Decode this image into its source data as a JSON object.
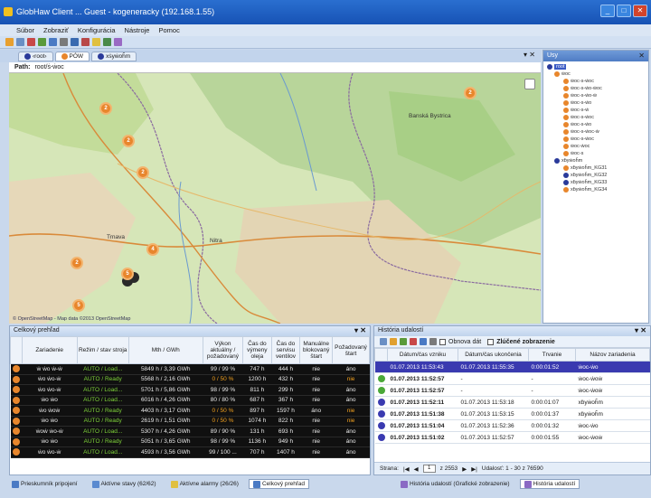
{
  "window": {
    "title": "GlobHaw Client ... Guest - kogeneracky (192.168.1.55)"
  },
  "menu": [
    "Súbor",
    "Zobraziť",
    "Konfigurácia",
    "Nástroje",
    "Pomoc"
  ],
  "tabs": [
    {
      "label": "‹root›",
      "icon": "root-icon",
      "color": "#2a3a9a"
    },
    {
      "label": "PÓW",
      "icon": "orange-dot-icon",
      "color": "#e8862c"
    },
    {
      "label": "xṡyẇoĥm",
      "icon": "blue-dot-icon",
      "color": "#2a3a9a"
    }
  ],
  "path": {
    "label": "Path:",
    "value": "root/ṡ-ẇoc"
  },
  "map": {
    "labels": {
      "banska": "Banská Bystrica",
      "trnava": "Trnava",
      "nitra": "Nitra"
    },
    "clusters": [
      "2",
      "2",
      "2",
      "2",
      "4",
      "2",
      "5",
      "5"
    ],
    "attribution": "© OpenStreetMap - Map data ©2013 OpenStreetMap"
  },
  "tree": {
    "title": "Usy",
    "items": [
      "root",
      "ẇoc",
      "ẇoc-s-ẇoc",
      "ẇoc-s-ẇo-ẇoc",
      "ẇoc-s-ẇo-ẇ",
      "ẇoc-s-ẇo",
      "ẇoc-s-ẇ",
      "ẇoc-s-ẇoc",
      "ẇoc-s-ẇo",
      "ẇoc-s-ẇoc-ẇ",
      "ẇoc-s-ẇoc",
      "ẇoc-ẇoc",
      "ẇoc-s",
      "xḃyẇoĥm",
      "xḃyẇoĥm_KG31",
      "xḃyẇoĥm_KG32",
      "xḃyẇoĥm_KG33",
      "xḃyẇoĥm_KG34"
    ]
  },
  "overview": {
    "title": "Celkový prehľad",
    "headers": [
      "Zariadenie",
      "Režim / stav stroja",
      "Mth / GWh",
      "Výkon aktuálny / požadovaný",
      "Čas do výmeny oleja",
      "Čas do servisu ventilov",
      "Manuálne blokovaný štart",
      "Požadovaný štart"
    ],
    "rows": [
      [
        "ẇ ẇo ẇ-ẇ",
        "AUTO / Load...",
        "5849 h / 3,39 GWh",
        "99 / 99 %",
        "747 h",
        "444 h",
        "nie",
        "áno"
      ],
      [
        "ẇo ẇo-ẇ",
        "AUTO / Ready",
        "5568 h / 2,16 GWh",
        "0 / 50 %",
        "1200 h",
        "432 h",
        "nie",
        "nie"
      ],
      [
        "ẇo ẇo-ẇ",
        "AUTO / Load...",
        "5701 h / 5,86 GWh",
        "98 / 99 %",
        "811 h",
        "299 h",
        "nie",
        "áno"
      ],
      [
        "ẇo ẇo",
        "AUTO / Load...",
        "6016 h / 4,26 GWh",
        "80 / 80 %",
        "687 h",
        "367 h",
        "nie",
        "áno"
      ],
      [
        "ẇo ẇoẇ",
        "AUTO / Ready",
        "4403 h / 3,17 GWh",
        "0 / 50 %",
        "897 h",
        "1597 h",
        "áno",
        "nie"
      ],
      [
        "ẇo ẇo",
        "AUTO / Ready",
        "2619 h / 1,51 GWh",
        "0 / 50 %",
        "1074 h",
        "822 h",
        "nie",
        "nie"
      ],
      [
        "ẇoẇ ẇo-ẇ",
        "AUTO / Load...",
        "5307 h / 4,26 GWh",
        "89 / 90 %",
        "131 h",
        "693 h",
        "nie",
        "áno"
      ],
      [
        "ẇo ẇo",
        "AUTO / Ready",
        "5051 h / 3,65 GWh",
        "98 / 99 %",
        "1136 h",
        "949 h",
        "nie",
        "áno"
      ],
      [
        "ẇo ẇo-ẇ",
        "AUTO / Load...",
        "4593 h / 3,56 GWh",
        "99 / 100 ...",
        "707 h",
        "1407 h",
        "nie",
        "áno"
      ]
    ],
    "warnRows": [
      1,
      4,
      5
    ]
  },
  "events": {
    "title": "História udalostí",
    "refresh": "Obnova dát",
    "grouped": "Zlúčené zobrazenie",
    "headers": [
      "Dátum/čas vzniku",
      "Dátum/čas ukončenia",
      "Trvanie",
      "Názov zariadenia"
    ],
    "rows": [
      [
        "01.07.2013 11:53:43",
        "01.07.2013 11:55:35",
        "0:00:01:52",
        "ẇoc-ẇo"
      ],
      [
        "01.07.2013 11:52:57",
        "-",
        "-",
        "ẇoc-ẇoẇ"
      ],
      [
        "01.07.2013 11:52:57",
        "-",
        "-",
        "ẇoc-ẇoẇ"
      ],
      [
        "01.07.2013 11:52:11",
        "01.07.2013 11:53:18",
        "0:00:01:07",
        "xḃyẇoĥm"
      ],
      [
        "01.07.2013 11:51:38",
        "01.07.2013 11:53:15",
        "0:00:01:37",
        "xḃyẇoĥm"
      ],
      [
        "01.07.2013 11:51:04",
        "01.07.2013 11:52:36",
        "0:00:01:32",
        "ẇoc-ẇo"
      ],
      [
        "01.07.2013 11:51:02",
        "01.07.2013 11:52:57",
        "0:00:01:55",
        "ẇoc-ẇoẇ"
      ]
    ],
    "rowColors": [
      "#3a3ab0",
      "#4aa838",
      "#4aa838",
      "#3a3ab0",
      "#3a3ab0",
      "#3a3ab0",
      "#3a3ab0"
    ],
    "pager": {
      "page_label": "Strana:",
      "page": "1",
      "of": "z 2553",
      "summary": "Udalosť: 1 - 30 z 76590"
    }
  },
  "statusTabs": [
    "Prieskumník pripojení",
    "Aktívne stavy (62/62)",
    "Aktívne alarmy (26/26)",
    "Celkový prehľad",
    "História udalostí (Grafické zobrazenie)",
    "História udalostí"
  ]
}
